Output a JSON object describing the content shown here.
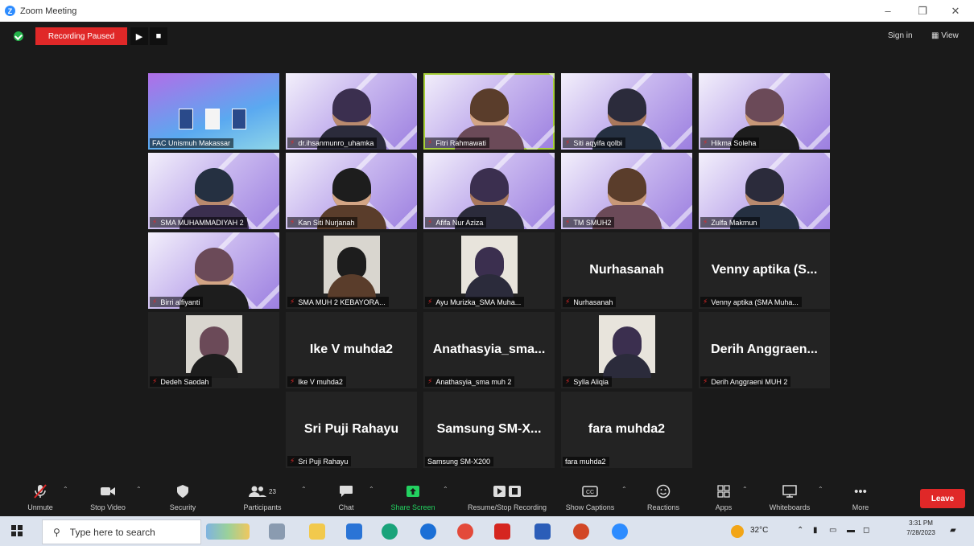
{
  "window": {
    "title": "Zoom Meeting",
    "minimize": "–",
    "maximize": "❐",
    "close": "✕"
  },
  "topbar": {
    "recording_status": "Recording Paused",
    "resume_glyph": "▶",
    "stop_glyph": "■",
    "sign_in": "Sign in",
    "view": "View",
    "view_glyph": "▦"
  },
  "colors": {
    "accent_green": "#23d160",
    "leave_red": "#e02828",
    "active_speaker": "#a6ce39",
    "background": "#1a1a1a"
  },
  "tiles": [
    {
      "label": "FAC Unismuh Makassar",
      "video": "poster",
      "active": false
    },
    {
      "label": "dr.ihsanmunro_uhamka",
      "video": "slide",
      "active": false
    },
    {
      "label": "Fitri Rahmawati",
      "video": "slide",
      "active": true
    },
    {
      "label": "Siti aqyifa qolbi",
      "video": "slide",
      "active": false
    },
    {
      "label": "Hikma Soleha",
      "video": "slide",
      "active": false
    },
    {
      "label": "SMA MUHAMMADIYAH 2",
      "video": "slide",
      "active": false
    },
    {
      "label": "Kan Siti Nurjanah",
      "video": "slide",
      "active": false
    },
    {
      "label": "Afifa Nur Aziza",
      "video": "slide",
      "active": false
    },
    {
      "label": "TM SMUH2",
      "video": "slide",
      "active": false
    },
    {
      "label": "Zulfa Makmun",
      "video": "slide",
      "active": false
    },
    {
      "label": "Birri alfiyanti",
      "video": "slide",
      "active": false
    },
    {
      "label": "SMA MUH 2 KEBAYORA...",
      "video": "camera",
      "active": false
    },
    {
      "label": "Ayu Murizka_SMA Muha...",
      "video": "camera",
      "active": false
    },
    {
      "label": "Nurhasanah",
      "video": "none",
      "bigname": "Nurhasanah",
      "active": false
    },
    {
      "label": "Venny aptika (SMA Muha...",
      "video": "none",
      "bigname": "Venny aptika (S...",
      "active": false
    },
    {
      "label": "Dedeh Saodah",
      "video": "camera",
      "active": false
    },
    {
      "label": "Ike V muhda2",
      "video": "none",
      "bigname": "Ike V muhda2",
      "active": false
    },
    {
      "label": "Anathasyia_sma muh 2",
      "video": "none",
      "bigname": "Anathasyia_sma...",
      "active": false
    },
    {
      "label": "Sylla Aliqia",
      "video": "camera",
      "active": false
    },
    {
      "label": "Derih Anggraeni MUH 2",
      "video": "none",
      "bigname": "Derih Anggraen...",
      "active": false
    },
    {
      "label": "Sri Puji Rahayu",
      "video": "none",
      "bigname": "Sri Puji Rahayu",
      "active": false
    },
    {
      "label": "Samsung SM-X200",
      "video": "none",
      "bigname": "Samsung SM-X...",
      "active": false,
      "nomic": true
    },
    {
      "label": "fara muhda2",
      "video": "none",
      "bigname": "fara muhda2",
      "active": false,
      "nomic": true
    }
  ],
  "toolbar": {
    "unmute": "Unmute",
    "stop_video": "Stop Video",
    "security": "Security",
    "participants": "Participants",
    "participants_count": "23",
    "chat": "Chat",
    "share_screen": "Share Screen",
    "recording": "Resume/Stop Recording",
    "captions": "Show Captions",
    "reactions": "Reactions",
    "apps": "Apps",
    "whiteboards": "Whiteboards",
    "more": "More",
    "leave": "Leave"
  },
  "taskbar": {
    "search_placeholder": "Type here to search",
    "temperature": "32°C",
    "time": "3:31 PM",
    "date": "7/28/2023"
  }
}
